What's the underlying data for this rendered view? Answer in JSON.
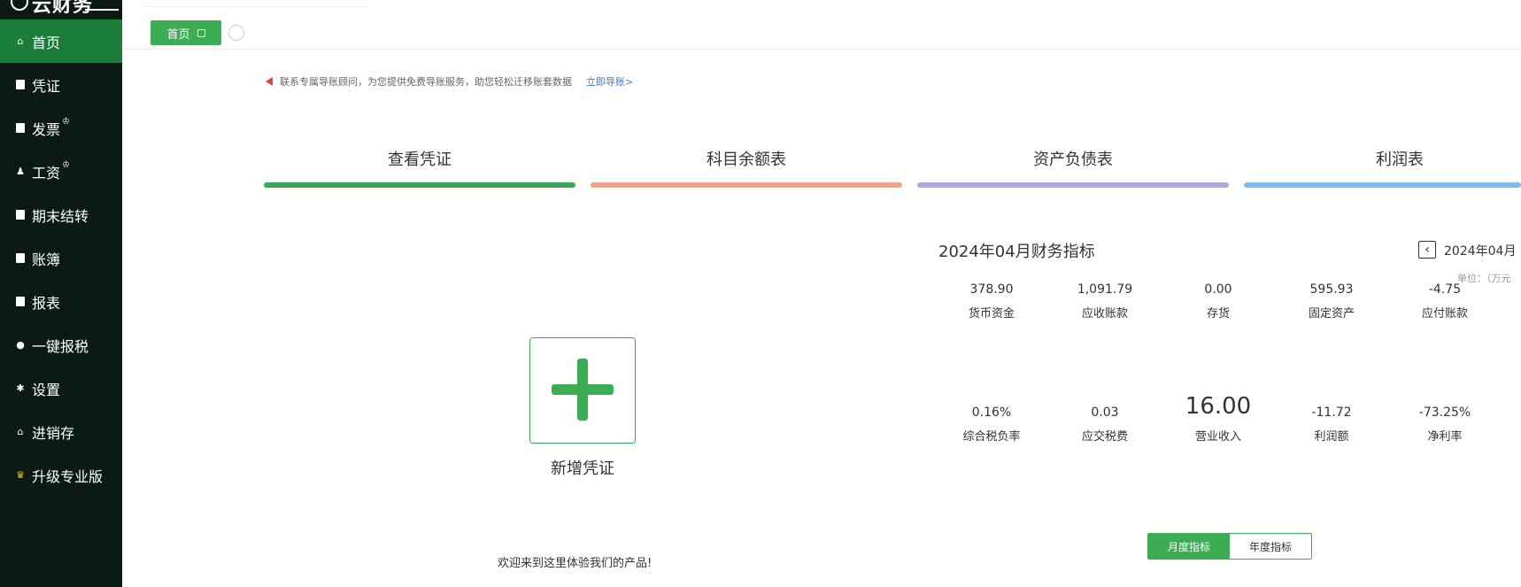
{
  "sidebar": {
    "brand": "云财务",
    "items": [
      {
        "label": "首页",
        "icon": "home-icon"
      },
      {
        "label": "凭证",
        "icon": "voucher-icon"
      },
      {
        "label": "发票",
        "icon": "invoice-icon",
        "badge_icon": "crown-icon"
      },
      {
        "label": "工资",
        "icon": "salary-icon",
        "badge_icon": "crown-icon"
      },
      {
        "label": "期末结转",
        "icon": "period-end-icon"
      },
      {
        "label": "账簿",
        "icon": "ledger-icon"
      },
      {
        "label": "报表",
        "icon": "report-icon"
      },
      {
        "label": "一键报税",
        "icon": "tax-icon"
      },
      {
        "label": "设置",
        "icon": "settings-icon"
      },
      {
        "label": "进销存",
        "icon": "inventory-icon"
      },
      {
        "label": "升级专业版",
        "icon": "upgrade-crown-icon"
      }
    ]
  },
  "tabs": {
    "home_label": "首页"
  },
  "notice": {
    "text": "联系专属导账顾问，为您提供免费导账服务，助您轻松迁移账套数据",
    "link": "立即导账>"
  },
  "quick_links": [
    {
      "label": "查看凭证",
      "color": "#3aa853"
    },
    {
      "label": "科目余额表",
      "color": "#f0a48a"
    },
    {
      "label": "资产负债表",
      "color": "#b3a5e0"
    },
    {
      "label": "利润表",
      "color": "#7cbdee"
    }
  ],
  "add_voucher": {
    "label": "新增凭证"
  },
  "welcome": "欢迎来到这里体验我们的产品!",
  "finance": {
    "title": "2024年04月财务指标",
    "period": "2024年04月",
    "unit": "单位：（万元",
    "row1": [
      {
        "value": "378.90",
        "label": "货币资金"
      },
      {
        "value": "1,091.79",
        "label": "应收账款"
      },
      {
        "value": "0.00",
        "label": "存货"
      },
      {
        "value": "595.93",
        "label": "固定资产"
      },
      {
        "value": "-4.75",
        "label": "应付账款"
      }
    ],
    "row2": [
      {
        "value": "0.16%",
        "label": "综合税负率"
      },
      {
        "value": "0.03",
        "label": "应交税费"
      },
      {
        "value": "16.00",
        "label": "营业收入"
      },
      {
        "value": "-11.72",
        "label": "利润额"
      },
      {
        "value": "-73.25%",
        "label": "净利率"
      }
    ],
    "monthly_tab": "月度指标",
    "yearly_tab": "年度指标"
  }
}
